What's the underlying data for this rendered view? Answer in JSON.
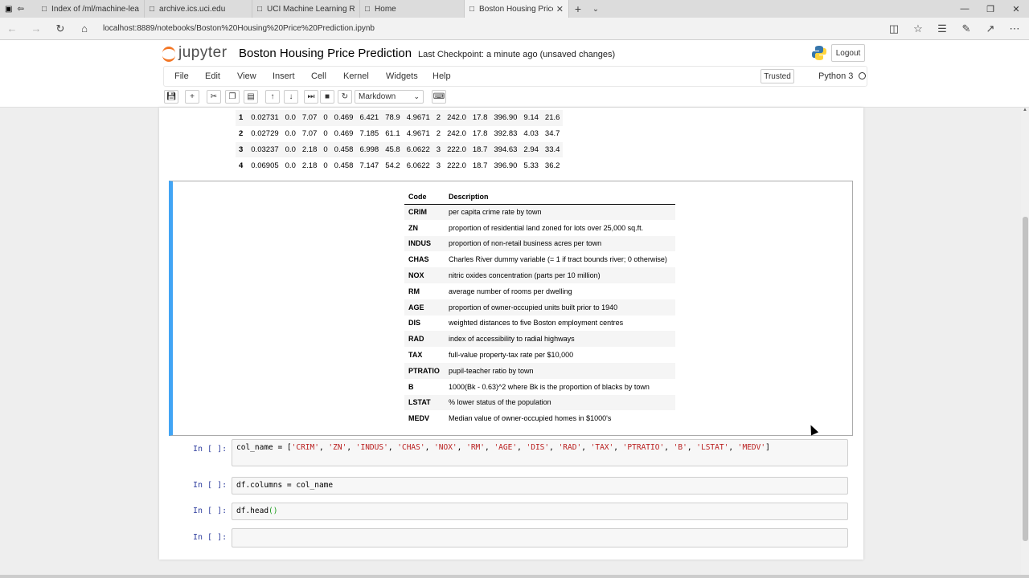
{
  "browser": {
    "tabs": [
      {
        "label": "Index of /ml/machine-learni"
      },
      {
        "label": "archive.ics.uci.edu"
      },
      {
        "label": "UCI Machine Learning Repo"
      },
      {
        "label": "Home"
      },
      {
        "label": "Boston Housing Price"
      }
    ],
    "url": "localhost:8889/notebooks/Boston%20Housing%20Price%20Prediction.ipynb"
  },
  "jupyter": {
    "logo_text": "jupyter",
    "notebook_title": "Boston Housing Price Prediction",
    "checkpoint": "Last Checkpoint: a minute ago (unsaved changes)",
    "logout_label": "Logout",
    "menu": [
      "File",
      "Edit",
      "View",
      "Insert",
      "Cell",
      "Kernel",
      "Widgets",
      "Help"
    ],
    "trusted_label": "Trusted",
    "kernel_name": "Python 3",
    "cell_type": "Markdown"
  },
  "dataframe_rows": [
    [
      "1",
      "0.02731",
      "0.0",
      "7.07",
      "0",
      "0.469",
      "6.421",
      "78.9",
      "4.9671",
      "2",
      "242.0",
      "17.8",
      "396.90",
      "9.14",
      "21.6"
    ],
    [
      "2",
      "0.02729",
      "0.0",
      "7.07",
      "0",
      "0.469",
      "7.185",
      "61.1",
      "4.9671",
      "2",
      "242.0",
      "17.8",
      "392.83",
      "4.03",
      "34.7"
    ],
    [
      "3",
      "0.03237",
      "0.0",
      "2.18",
      "0",
      "0.458",
      "6.998",
      "45.8",
      "6.0622",
      "3",
      "222.0",
      "18.7",
      "394.63",
      "2.94",
      "33.4"
    ],
    [
      "4",
      "0.06905",
      "0.0",
      "2.18",
      "0",
      "0.458",
      "7.147",
      "54.2",
      "6.0622",
      "3",
      "222.0",
      "18.7",
      "396.90",
      "5.33",
      "36.2"
    ]
  ],
  "description_table": {
    "headers": [
      "Code",
      "Description"
    ],
    "rows": [
      [
        "CRIM",
        "per capita crime rate by town"
      ],
      [
        "ZN",
        "proportion of residential land zoned for lots over 25,000 sq.ft."
      ],
      [
        "INDUS",
        "proportion of non-retail business acres per town"
      ],
      [
        "CHAS",
        "Charles River dummy variable (= 1 if tract bounds river; 0 otherwise)"
      ],
      [
        "NOX",
        "nitric oxides concentration (parts per 10 million)"
      ],
      [
        "RM",
        "average number of rooms per dwelling"
      ],
      [
        "AGE",
        "proportion of owner-occupied units built prior to 1940"
      ],
      [
        "DIS",
        "weighted distances to five Boston employment centres"
      ],
      [
        "RAD",
        "index of accessibility to radial highways"
      ],
      [
        "TAX",
        "full-value property-tax rate per $10,000"
      ],
      [
        "PTRATIO",
        "pupil-teacher ratio by town"
      ],
      [
        "B",
        "1000(Bk - 0.63)^2 where Bk is the proportion of blacks by town"
      ],
      [
        "LSTAT",
        "% lower status of the population"
      ],
      [
        "MEDV",
        "Median value of owner-occupied homes in $1000's"
      ]
    ]
  },
  "code_cells": {
    "prompt": "In [ ]:",
    "cell1_prefix": "col_name = [",
    "cell1_items": [
      "'CRIM'",
      "'ZN'",
      "'INDUS'",
      "'CHAS'",
      "'NOX'",
      "'RM'",
      "'AGE'",
      "'DIS'",
      "'RAD'",
      "'TAX'",
      "'PTRATIO'",
      "'B'",
      "'LSTAT'",
      "'MEDV'"
    ],
    "cell1_suffix": "]",
    "cell2": "df.columns = col_name",
    "cell3_name": "df.head",
    "cell3_parens": "()",
    "cell4": ""
  }
}
